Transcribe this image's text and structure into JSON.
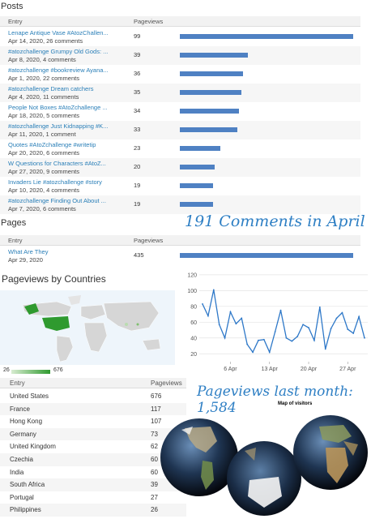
{
  "posts": {
    "title": "Posts",
    "col_entry": "Entry",
    "col_pageviews": "Pageviews",
    "items": [
      {
        "title": "Lenape Antique Vase #AtozChallen...",
        "meta": "Apr 14, 2020, 26 comments",
        "views": "99",
        "value": 99
      },
      {
        "title": "#atozchallenge Grumpy Old Gods: ...",
        "meta": "Apr 8, 2020, 4 comments",
        "views": "39",
        "value": 39
      },
      {
        "title": "#atozchallenge #bookreview Ayana...",
        "meta": "Apr 1, 2020, 22 comments",
        "views": "36",
        "value": 36
      },
      {
        "title": "#atozchallenge Dream catchers",
        "meta": "Apr 4, 2020, 11 comments",
        "views": "35",
        "value": 35
      },
      {
        "title": "People Not Boxes #AtoZchallenge ...",
        "meta": "Apr 18, 2020, 5 comments",
        "views": "34",
        "value": 34
      },
      {
        "title": "#atozchallenge Just Kidnapping #K...",
        "meta": "Apr 11, 2020, 1 comment",
        "views": "33",
        "value": 33
      },
      {
        "title": "Quotes #AtoZchallenge #writetip",
        "meta": "Apr 20, 2020, 6 comments",
        "views": "23",
        "value": 23
      },
      {
        "title": "W Questions for Characters #AtoZ...",
        "meta": "Apr 27, 2020, 9 comments",
        "views": "20",
        "value": 20
      },
      {
        "title": "Invaders Lie #atozchallenge #story",
        "meta": "Apr 10, 2020, 4 comments",
        "views": "19",
        "value": 19
      },
      {
        "title": "#atozchallenge Finding Out About ...",
        "meta": "Apr 7, 2020, 6 comments",
        "views": "19",
        "value": 19
      }
    ]
  },
  "comments_banner": "191 Comments in April",
  "pages": {
    "title": "Pages",
    "col_entry": "Entry",
    "col_pageviews": "Pageviews",
    "items": [
      {
        "title": "What Are They",
        "meta": "Apr 29, 2020",
        "views": "435",
        "value": 435
      }
    ]
  },
  "countries": {
    "title": "Pageviews by Countries",
    "legend_min": "26",
    "legend_max": "676",
    "col_entry": "Entry",
    "col_pageviews": "Pageviews",
    "items": [
      {
        "name": "United States",
        "views": "676"
      },
      {
        "name": "France",
        "views": "117"
      },
      {
        "name": "Hong Kong",
        "views": "107"
      },
      {
        "name": "Germany",
        "views": "73"
      },
      {
        "name": "United Kingdom",
        "views": "62"
      },
      {
        "name": "Czechia",
        "views": "60"
      },
      {
        "name": "India",
        "views": "60"
      },
      {
        "name": "South Africa",
        "views": "39"
      },
      {
        "name": "Portugal",
        "views": "27"
      },
      {
        "name": "Philippines",
        "views": "26"
      }
    ]
  },
  "pageviews_banner_line1": "Pageviews last month:",
  "pageviews_banner_line2": "1,584",
  "map_of_visitors": "Map of visitors",
  "colors": {
    "accent": "#2a7fb8",
    "bar": "#4f81c3",
    "map_green": "#2f9a2f"
  },
  "chart_data": {
    "type": "line",
    "x_ticks": [
      "6 Apr",
      "13 Apr",
      "20 Apr",
      "27 Apr"
    ],
    "x": [
      "Apr 1",
      "Apr 2",
      "Apr 3",
      "Apr 4",
      "Apr 5",
      "Apr 6",
      "Apr 7",
      "Apr 8",
      "Apr 9",
      "Apr 10",
      "Apr 11",
      "Apr 12",
      "Apr 13",
      "Apr 14",
      "Apr 15",
      "Apr 16",
      "Apr 17",
      "Apr 18",
      "Apr 19",
      "Apr 20",
      "Apr 21",
      "Apr 22",
      "Apr 23",
      "Apr 24",
      "Apr 25",
      "Apr 26",
      "Apr 27",
      "Apr 28",
      "Apr 29",
      "Apr 30"
    ],
    "values": [
      83,
      68,
      101,
      57,
      40,
      73,
      58,
      65,
      32,
      22,
      37,
      38,
      22,
      48,
      75,
      40,
      36,
      42,
      57,
      53,
      37,
      79,
      26,
      52,
      65,
      72,
      51,
      46,
      67,
      40
    ],
    "y_ticks": [
      20,
      40,
      60,
      80,
      100,
      120
    ],
    "ylim": [
      10,
      125
    ],
    "grid": true,
    "color": "#2e78c8"
  }
}
